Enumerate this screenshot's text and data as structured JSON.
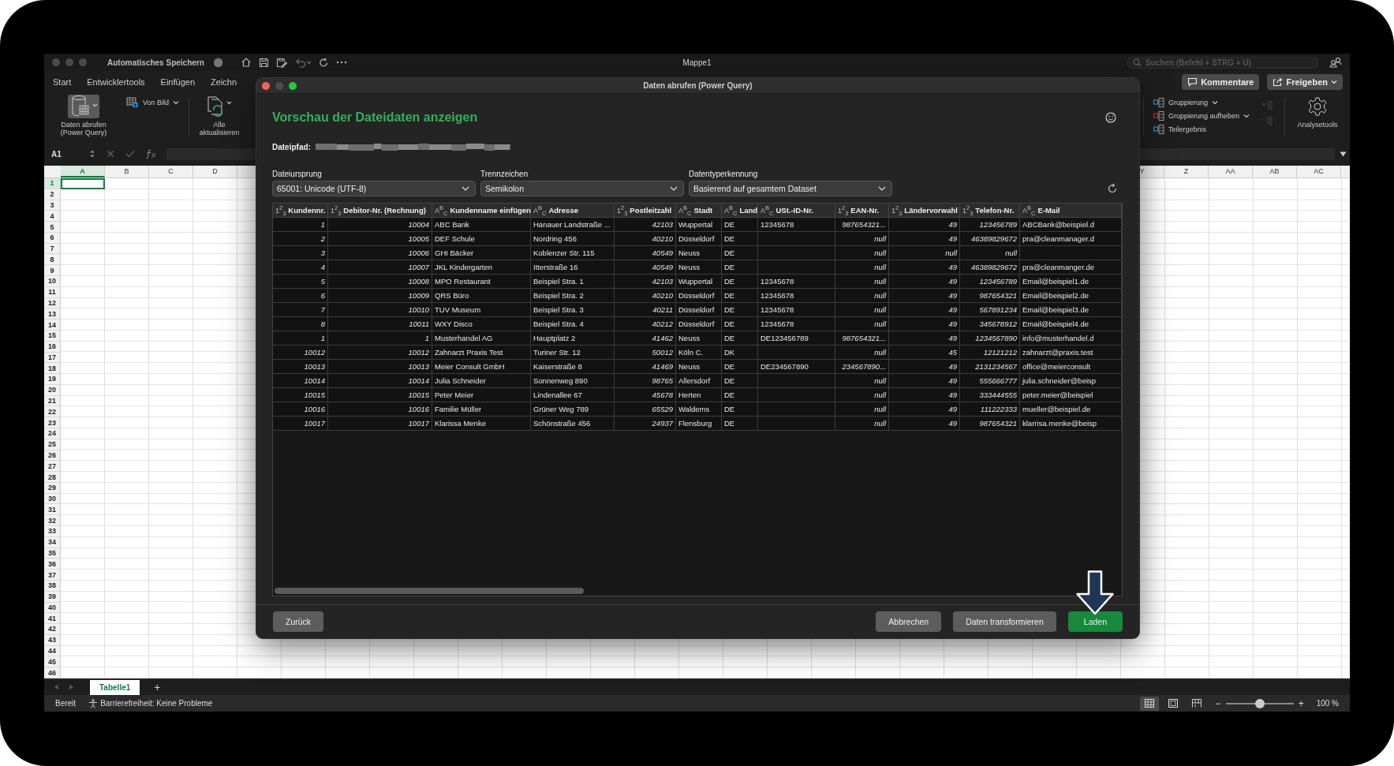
{
  "excel": {
    "titlebar": {
      "autosave_label": "Automatisches Speichern",
      "autosave_on": false,
      "title": "Mappe1",
      "search": {
        "placeholder": "Suchen (Befehl + STRG + U)"
      }
    },
    "ribbon_tabs": [
      "Start",
      "Entwicklertools",
      "Einfügen",
      "Zeichn"
    ],
    "ribbon_actions": [
      "Kommentare",
      "Freigeben"
    ],
    "get_data": {
      "label": "Daten abrufen (Power Query)",
      "pressed": true
    },
    "from_picture": {
      "label": "Von Bild"
    },
    "refresh_all": {
      "label": "Alle aktualisieren"
    },
    "grouping": [
      {
        "label": "Gruppierung",
        "caret": true
      },
      {
        "label": "Gruppierung aufheben",
        "caret": true
      },
      {
        "label": "Teilergebnis",
        "caret": false
      }
    ],
    "analysis_tools": {
      "label": "Analysetools"
    },
    "name_box": "A1",
    "columns_left": [
      {
        "label": "A",
        "selected": true
      },
      {
        "label": "B",
        "selected": false
      },
      {
        "label": "C",
        "selected": false
      },
      {
        "label": "D",
        "selected": false
      }
    ],
    "columns_right": [
      {
        "label": "Y",
        "selected": false
      },
      {
        "label": "Z",
        "selected": false
      },
      {
        "label": "AA",
        "selected": false
      },
      {
        "label": "AB",
        "selected": false
      },
      {
        "label": "AC",
        "selected": false
      }
    ],
    "rows": [
      {
        "label": "1",
        "selected": true
      },
      {
        "label": "2",
        "selected": false
      },
      {
        "label": "3",
        "selected": false
      },
      {
        "label": "4",
        "selected": false
      },
      {
        "label": "5",
        "selected": false
      },
      {
        "label": "6",
        "selected": false
      },
      {
        "label": "7",
        "selected": false
      },
      {
        "label": "8",
        "selected": false
      },
      {
        "label": "9",
        "selected": false
      },
      {
        "label": "10",
        "selected": false
      },
      {
        "label": "11",
        "selected": false
      },
      {
        "label": "12",
        "selected": false
      },
      {
        "label": "13",
        "selected": false
      },
      {
        "label": "14",
        "selected": false
      },
      {
        "label": "15",
        "selected": false
      },
      {
        "label": "16",
        "selected": false
      },
      {
        "label": "17",
        "selected": false
      },
      {
        "label": "18",
        "selected": false
      },
      {
        "label": "19",
        "selected": false
      },
      {
        "label": "20",
        "selected": false
      },
      {
        "label": "21",
        "selected": false
      },
      {
        "label": "22",
        "selected": false
      },
      {
        "label": "23",
        "selected": false
      },
      {
        "label": "24",
        "selected": false
      },
      {
        "label": "25",
        "selected": false
      },
      {
        "label": "26",
        "selected": false
      },
      {
        "label": "27",
        "selected": false
      },
      {
        "label": "28",
        "selected": false
      },
      {
        "label": "29",
        "selected": false
      },
      {
        "label": "30",
        "selected": false
      },
      {
        "label": "31",
        "selected": false
      },
      {
        "label": "32",
        "selected": false
      },
      {
        "label": "33",
        "selected": false
      },
      {
        "label": "34",
        "selected": false
      },
      {
        "label": "35",
        "selected": false
      },
      {
        "label": "36",
        "selected": false
      },
      {
        "label": "37",
        "selected": false
      },
      {
        "label": "38",
        "selected": false
      },
      {
        "label": "39",
        "selected": false
      },
      {
        "label": "40",
        "selected": false
      },
      {
        "label": "41",
        "selected": false
      },
      {
        "label": "42",
        "selected": false
      },
      {
        "label": "43",
        "selected": false
      },
      {
        "label": "44",
        "selected": false
      },
      {
        "label": "45",
        "selected": false
      },
      {
        "label": "46",
        "selected": false
      }
    ],
    "sheet_tabs": [
      {
        "label": "Tabelle1",
        "selected": true
      }
    ],
    "sheet_add": "+",
    "status": {
      "ready": "Bereit",
      "accessibility": "Barrierefreiheit: Keine Probleme",
      "views": [
        {
          "kind": "normal",
          "selected": true
        },
        {
          "kind": "page_layout",
          "selected": false
        },
        {
          "kind": "page_break",
          "selected": false
        }
      ],
      "zoom": {
        "minus": "−",
        "plus": "+",
        "level": 0.5,
        "reading": "100 %"
      }
    }
  },
  "dialog": {
    "title": "Daten abrufen (Power Query)",
    "heading": "Vorschau der Dateidaten anzeigen",
    "path_label": "Dateipfad:",
    "path_redacted": true,
    "dropdowns": [
      {
        "label": "Dateiursprung",
        "value": "65001: Unicode (UTF-8)"
      },
      {
        "label": "Trennzeichen",
        "value": "Semikolon"
      },
      {
        "label": "Datentyperkennung",
        "value": "Basierend auf gesamtem Dataset"
      }
    ],
    "table": {
      "columns": [
        {
          "kind": "number",
          "type_icon": "1$^{2}$$_{3}$",
          "label": "Kundennr."
        },
        {
          "kind": "number",
          "type_icon": "1$^{2}$$_{3}$",
          "label": "Debitor-Nr. (Rechnung)"
        },
        {
          "kind": "text",
          "type_icon": "A$^{B}$$_{C}$",
          "label": "Kundenname einfügen"
        },
        {
          "kind": "text",
          "type_icon": "A$^{B}$$_{C}$",
          "label": "Adresse"
        },
        {
          "kind": "number",
          "type_icon": "1$^{2}$$_{3}$",
          "label": "Postleitzahl"
        },
        {
          "kind": "text",
          "type_icon": "A$^{B}$$_{C}$",
          "label": "Stadt"
        },
        {
          "kind": "text",
          "type_icon": "A$^{B}$$_{C}$",
          "label": "Land"
        },
        {
          "kind": "text",
          "type_icon": "A$^{B}$$_{C}$",
          "label": "USt.-ID-Nr."
        },
        {
          "kind": "number",
          "type_icon": "1$^{2}$$_{3}$",
          "label": "EAN-Nr."
        },
        {
          "kind": "number",
          "type_icon": "1$^{2}$$_{3}$",
          "label": "Ländervorwahl"
        },
        {
          "kind": "number",
          "type_icon": "1$^{2}$$_{3}$",
          "label": "Telefon-Nr."
        },
        {
          "kind": "text",
          "type_icon": "A$^{B}$$_{C}$",
          "label": "E-Mail"
        }
      ],
      "rows": [
        [
          "1",
          "10004",
          "ABC Bank",
          "Hanauer Landstraße ...",
          "42103",
          "Wuppertal",
          "DE",
          "12345678",
          "987654321...",
          "49",
          "123456789",
          "ABCBank@beispiel.d"
        ],
        [
          "2",
          "10005",
          "DEF Schule",
          "Nordring 456",
          "40210",
          "Düsseldorf",
          "DE",
          null,
          "null",
          "49",
          "46389829672",
          "pra@cleanmanager.d"
        ],
        [
          "3",
          "10006",
          "GHI Bäcker",
          "Koblenzer Str. 115",
          "40549",
          "Neuss",
          "DE",
          null,
          "null",
          "null",
          "null",
          null
        ],
        [
          "4",
          "10007",
          "JKL Kindergarten",
          "Itterstraße 16",
          "40549",
          "Neuss",
          "DE",
          null,
          "null",
          "49",
          "46389829672",
          "pra@cleanmanger.de"
        ],
        [
          "5",
          "10008",
          "MPO Restaurant",
          "Beispiel Stra. 1",
          "42103",
          "Wuppertal",
          "DE",
          "12345678",
          "null",
          "49",
          "123456789",
          "Email@beispiel1.de"
        ],
        [
          "6",
          "10009",
          "QRS Büro",
          "Beispiel Stra. 2",
          "40210",
          "Düsseldorf",
          "DE",
          "12345678",
          "null",
          "49",
          "987654321",
          "Email@beispiel2.de"
        ],
        [
          "7",
          "10010",
          "TUV Museum",
          "Beispiel Stra. 3",
          "40211",
          "Düsseldorf",
          "DE",
          "12345678",
          "null",
          "49",
          "567891234",
          "Email@beispiel3.de"
        ],
        [
          "8",
          "10011",
          "WXY Disco",
          "Beispiel Stra. 4",
          "40212",
          "Düsseldorf",
          "DE",
          "12345678",
          "null",
          "49",
          "345678912",
          "Email@beispiel4.de"
        ],
        [
          "1",
          "1",
          "Musterhandel AG",
          "Hauptplatz 2",
          "41462",
          "Neuss",
          "DE",
          "DE123456789",
          "987654321...",
          "49",
          "1234567890",
          "info@musterhandel.d"
        ],
        [
          "10012",
          "10012",
          "Zahnarzt Praxis Test",
          "Turiner Str. 12",
          "50012",
          "Köln C.",
          "DK",
          null,
          "null",
          "45",
          "12121212",
          "zahnarzt@praxis.test"
        ],
        [
          "10013",
          "10013",
          "Meier Consult GmbH",
          "Kaiserstraße 8",
          "41469",
          "Neuss",
          "DE",
          "DE234567890",
          "234567890...",
          "49",
          "2131234567",
          "office@meierconsult"
        ],
        [
          "10014",
          "10014",
          "Julia Schneider",
          "Sonnenweg 890",
          "98765",
          "Allersdorf",
          "DE",
          null,
          "null",
          "49",
          "555666777",
          "julia.schneider@beisp"
        ],
        [
          "10015",
          "10015",
          "Peter Meier",
          "Lindenallee 67",
          "45678",
          "Herten",
          "DE",
          null,
          "null",
          "49",
          "333444555",
          "peter.meier@beispiel"
        ],
        [
          "10016",
          "10016",
          "Familie Müller",
          "Grüner Weg 789",
          "65529",
          "Waldems",
          "DE",
          null,
          "null",
          "49",
          "111222333",
          "mueller@beispiel.de"
        ],
        [
          "10017",
          "10017",
          "Klarissa Menke",
          "Schönstraße 456",
          "24937",
          "Flensburg",
          "DE",
          null,
          "null",
          "49",
          "987654321",
          "klarrisa.menke@beisp"
        ]
      ]
    },
    "buttons_left": [
      {
        "label": "Zurück"
      }
    ],
    "buttons_right": [
      {
        "label": "Abbrechen",
        "kind": "secondary"
      },
      {
        "label": "Daten transformieren",
        "kind": "secondary"
      },
      {
        "label": "Laden",
        "kind": "primary"
      }
    ],
    "annotation": {
      "kind": "arrow"
    }
  }
}
